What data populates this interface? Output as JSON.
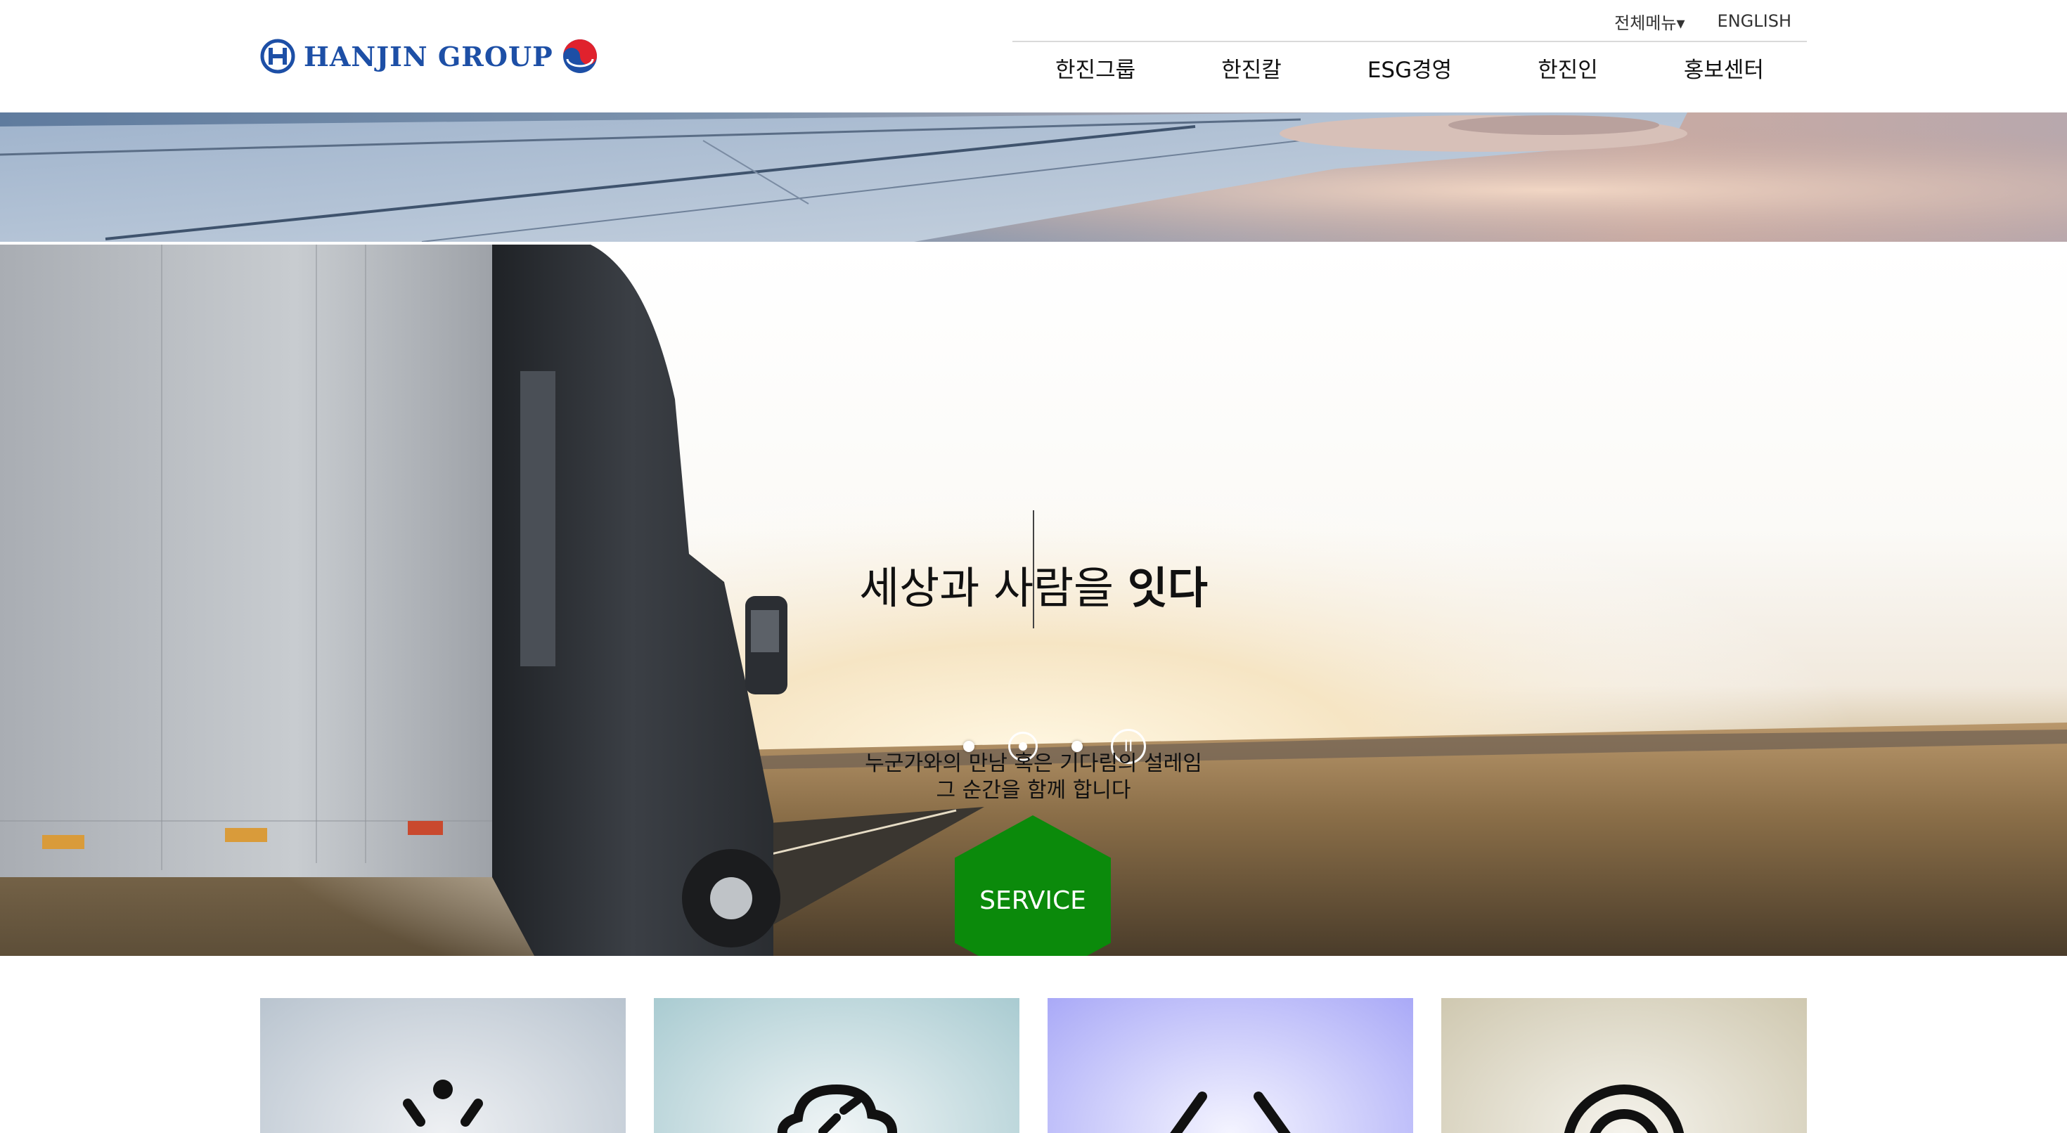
{
  "header": {
    "logo_text": "HANJIN GROUP",
    "utility": {
      "all_menu": "전체메뉴▾",
      "english": "ENGLISH"
    },
    "nav": [
      {
        "label": "한진그룹"
      },
      {
        "label": "한진칼"
      },
      {
        "label": "ESG경영"
      },
      {
        "label": "한진인"
      },
      {
        "label": "홍보센터"
      }
    ]
  },
  "hero": {
    "slogan_normal": "세상과 사람을 ",
    "slogan_bold": "잇다",
    "sub_line1": "누군가와의 만남 혹은 기다림의 설레임",
    "sub_line2": "그 순간을 함께 합니다",
    "service_label": "SERVICE",
    "pause_symbol": "II",
    "slide_count": 3,
    "active_slide": 2
  },
  "cards": [
    {
      "icon": "sun-icon",
      "bg": "#c3ccd6"
    },
    {
      "icon": "cloud-check-icon",
      "bg": "#c6dde0"
    },
    {
      "icon": "code-brackets-icon",
      "bg": "#b7b7f8"
    },
    {
      "icon": "target-icon",
      "bg": "#d9d4c3"
    }
  ],
  "colors": {
    "brand_blue": "#1d4fa6",
    "service_green": "#0b8a0b"
  }
}
